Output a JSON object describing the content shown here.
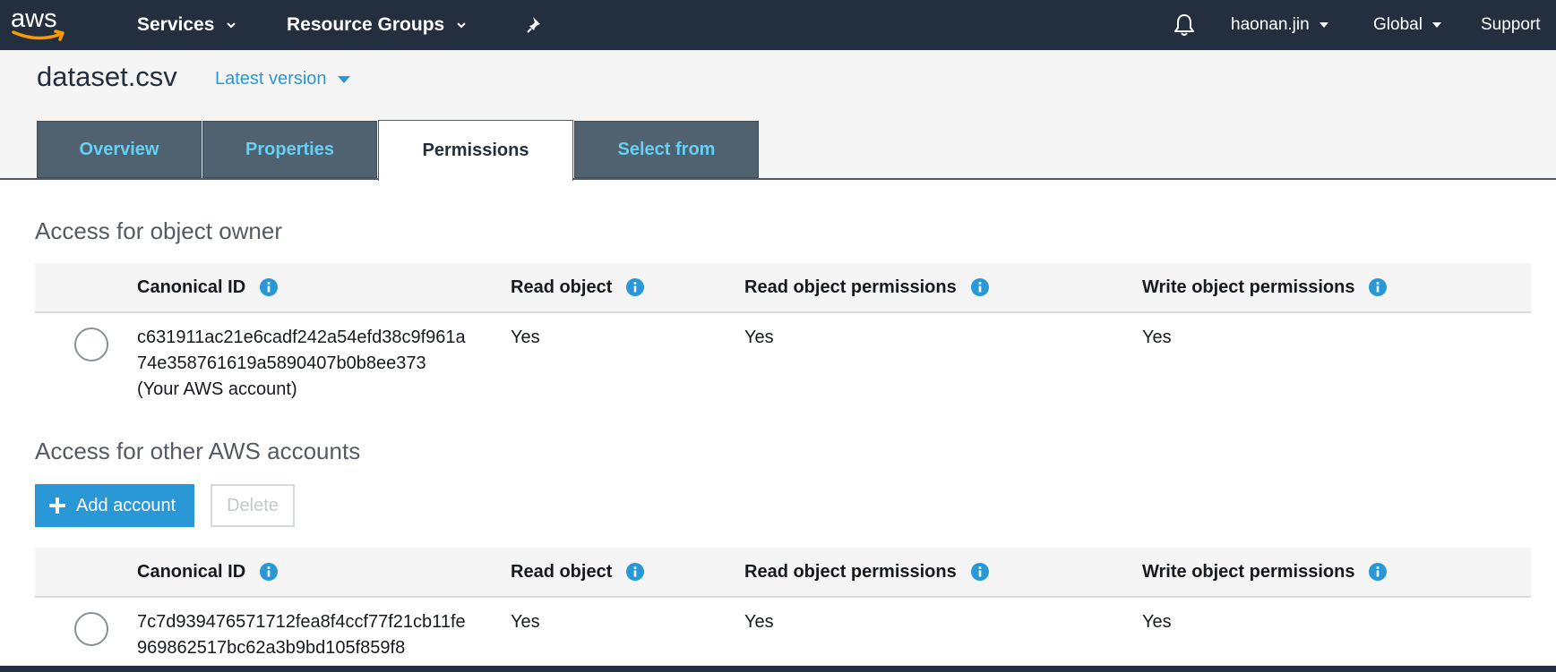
{
  "nav": {
    "logo_text": "aws",
    "services": "Services",
    "resource_groups": "Resource Groups",
    "user": "haonan.jin",
    "region": "Global",
    "support": "Support"
  },
  "object": {
    "name": "dataset.csv",
    "version": "Latest version"
  },
  "tabs": [
    {
      "label": "Overview",
      "active": false
    },
    {
      "label": "Properties",
      "active": false
    },
    {
      "label": "Permissions",
      "active": true
    },
    {
      "label": "Select from",
      "active": false
    }
  ],
  "owner_section": {
    "title": "Access for object owner",
    "columns": [
      "Canonical ID",
      "Read object",
      "Read object permissions",
      "Write object permissions"
    ],
    "rows": [
      {
        "id_line1": "c631911ac21e6cadf242a54efd38c9f961a",
        "id_line2": "74e358761619a5890407b0b8ee373",
        "id_note": "(Your AWS account)",
        "read_object": "Yes",
        "read_permissions": "Yes",
        "write_permissions": "Yes"
      }
    ]
  },
  "other_section": {
    "title": "Access for other AWS accounts",
    "add_button": "Add account",
    "delete_button": "Delete",
    "columns": [
      "Canonical ID",
      "Read object",
      "Read object permissions",
      "Write object permissions"
    ],
    "rows": [
      {
        "id_line1": "7c7d939476571712fea8f4ccf77f21cb11fe",
        "id_line2": "969862517bc62a3b9bd105f859f8",
        "read_object": "Yes",
        "read_permissions": "Yes",
        "write_permissions": "Yes"
      }
    ]
  },
  "colors": {
    "nav_bg": "#232f3e",
    "accent_blue": "#2a97d6",
    "tab_bg": "#50626f",
    "tab_text": "#66cff3",
    "aws_orange": "#ff9900"
  },
  "icons": [
    "aws-logo",
    "chevron-down-icon",
    "pin-icon",
    "bell-icon",
    "caret-down-icon",
    "info-icon",
    "plus-icon",
    "radio-button"
  ]
}
